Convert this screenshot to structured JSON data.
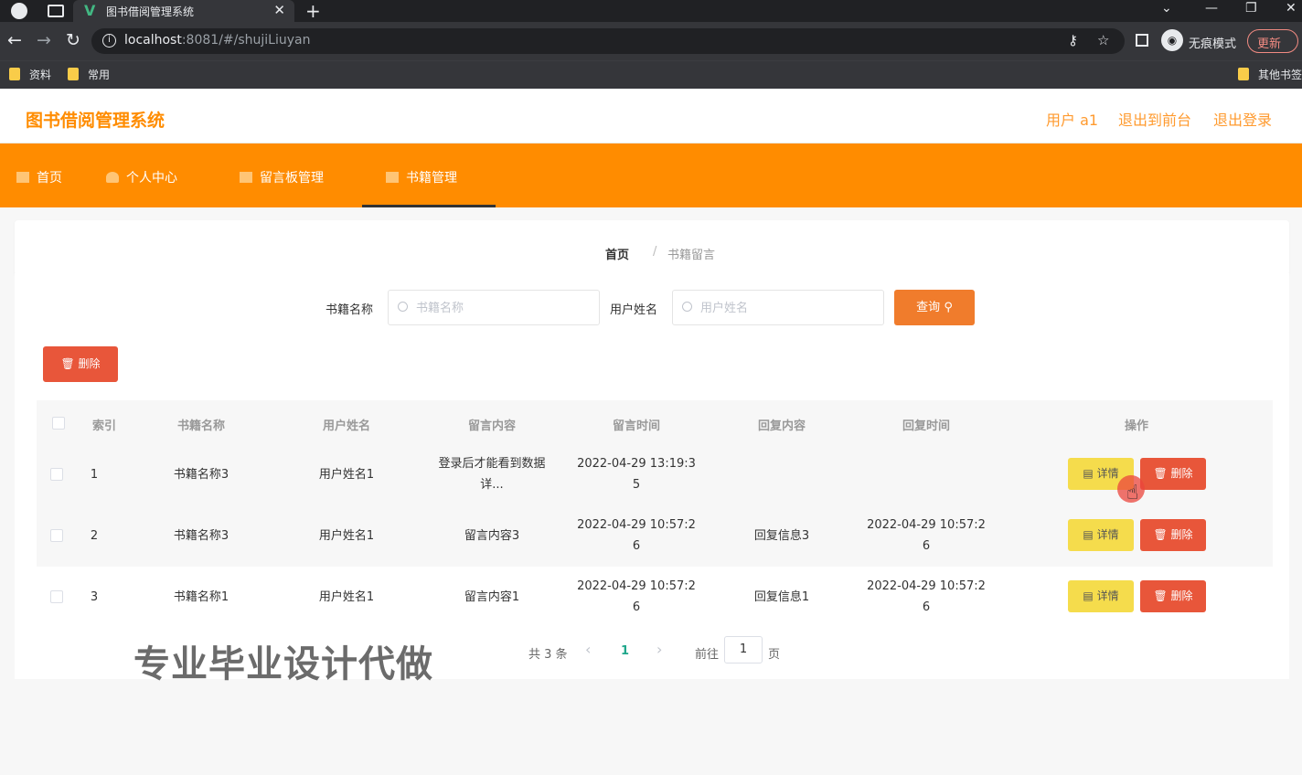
{
  "browser": {
    "tab_title": "图书借阅管理系统",
    "tab_favicon": "V",
    "url_host": "localhost",
    "url_rest": ":8081/#/shujiLiuyan",
    "incognito_label": "无痕模式",
    "update_label": "更新",
    "bookmarks": [
      "资料",
      "常用",
      "其他书签"
    ]
  },
  "app": {
    "title": "图书借阅管理系统",
    "header_links": [
      "用户 a1",
      "退出到前台",
      "退出登录"
    ],
    "nav": [
      "首页",
      "个人中心",
      "留言板管理",
      "书籍管理"
    ],
    "active_nav": "书籍管理",
    "accent": "#ff8c00"
  },
  "breadcrumb": {
    "home": "首页",
    "sep": "/",
    "current": "书籍留言"
  },
  "filters": {
    "book_label": "书籍名称",
    "book_placeholder": "书籍名称",
    "user_label": "用户姓名",
    "user_placeholder": "用户姓名",
    "query_label": "查询",
    "bulk_delete_label": "删除"
  },
  "table": {
    "headers": [
      "索引",
      "书籍名称",
      "用户姓名",
      "留言内容",
      "留言时间",
      "回复内容",
      "回复时间",
      "操作"
    ],
    "detail_label": "详情",
    "delete_label": "删除",
    "rows": [
      {
        "index": "1",
        "book": "书籍名称3",
        "user": "用户姓名1",
        "content_l1": "登录后才能看到数据",
        "content_l2": "详...",
        "time_l1": "2022-04-29 13:19:3",
        "time_l2": "5",
        "reply": "",
        "reply_time_l1": "",
        "reply_time_l2": ""
      },
      {
        "index": "2",
        "book": "书籍名称3",
        "user": "用户姓名1",
        "content_l1": "留言内容3",
        "content_l2": "",
        "time_l1": "2022-04-29 10:57:2",
        "time_l2": "6",
        "reply": "回复信息3",
        "reply_time_l1": "2022-04-29 10:57:2",
        "reply_time_l2": "6"
      },
      {
        "index": "3",
        "book": "书籍名称1",
        "user": "用户姓名1",
        "content_l1": "留言内容1",
        "content_l2": "",
        "time_l1": "2022-04-29 10:57:2",
        "time_l2": "6",
        "reply": "回复信息1",
        "reply_time_l1": "2022-04-29 10:57:2",
        "reply_time_l2": "6"
      }
    ]
  },
  "pagination": {
    "total": "共 3 条",
    "current": "1",
    "goto_label": "前往",
    "goto_value": "1",
    "page_label": "页"
  },
  "watermark": "专业毕业设计代做"
}
